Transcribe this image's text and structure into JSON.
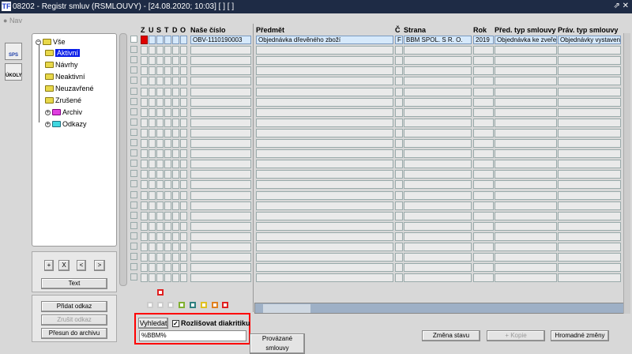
{
  "window": {
    "title": "08202 - Registr smluv (RSMLOUVY) - [24.08.2020; 10:03]  [ ]  [ ]",
    "logo": "TF",
    "controls": "⇗ ✕"
  },
  "toolbar": {
    "nav": "Nav"
  },
  "side_icons": [
    {
      "label": "SPS",
      "icon": "sps-icon"
    },
    {
      "label": "ÚKOLY",
      "icon": "tasks-icon"
    }
  ],
  "tree": {
    "root": "Vše",
    "items": [
      "Aktivní",
      "Návrhy",
      "Neaktivní",
      "Neuzavřené",
      "Zrušené"
    ],
    "archiv": "Archiv",
    "odkazy": "Odkazy",
    "selected": "Aktivní"
  },
  "tree_buttons": {
    "plus": "+",
    "x": "X",
    "lt": "<",
    "gt": ">",
    "text": "Text"
  },
  "link_buttons": {
    "add": "Přidat odkaz",
    "remove": "Zrušit odkaz",
    "move": "Přesun do archivu"
  },
  "grid": {
    "flag_headers": [
      "Z",
      "U",
      "S",
      "T",
      "D",
      "O"
    ],
    "columns": [
      "Naše číslo",
      "Předmět",
      "Č",
      "Strana",
      "Rok",
      "Před. typ smlouvy",
      "Práv. typ smlouvy"
    ],
    "rows": [
      {
        "nase_cislo": "OBV-1110190003",
        "predmet": "Objednávka dřevěného zboží",
        "c": "F",
        "strana": "BBM SPOL. S R. O.",
        "rok": "2019",
        "pred_typ": "Objednávka ke zveřejn",
        "prav_typ": "Objednávky vystavené"
      }
    ],
    "empty_rows": 23
  },
  "search": {
    "button": "Vyhledat",
    "checkbox_label": "Rozlišovat diakritiku",
    "checked": true,
    "value": "%BBM%"
  },
  "actions": {
    "linked": "Provázané smlouvy",
    "change_state": "Změna stavu",
    "copy": "+ Kopie",
    "bulk": "Hromadné změny"
  },
  "colors": {
    "title_bg": "#1e2b45",
    "highlight": "#ff0000",
    "selected": "#0a1ee8"
  }
}
